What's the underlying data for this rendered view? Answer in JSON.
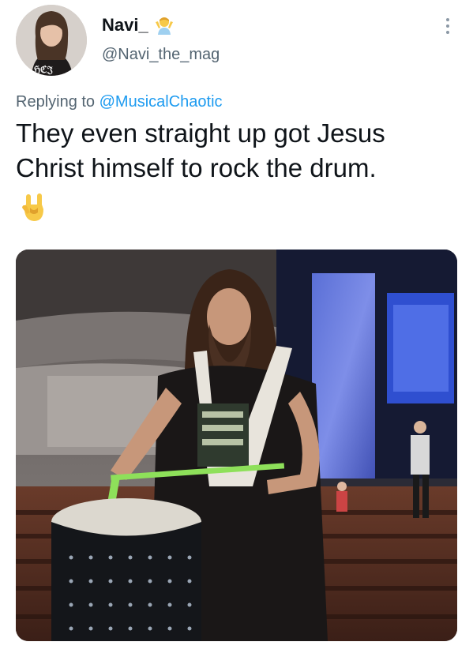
{
  "author": {
    "display_name": "Navi_",
    "handle": "@Navi_the_mag"
  },
  "reply": {
    "prefix": "Replying to ",
    "mention": "@MusicalChaotic"
  },
  "tweet": {
    "line1": "They even straight up got Jesus",
    "line2": "Christ himself to rock the drum."
  },
  "icons": {
    "badge_emoji": "person-gesturing-emoji-icon",
    "hand_emoji": "sign-of-the-horns-emoji-icon",
    "more": "more-options-icon"
  },
  "colors": {
    "link": "#1d9bf0",
    "secondary_text": "#536471",
    "primary_text": "#0f1419"
  }
}
